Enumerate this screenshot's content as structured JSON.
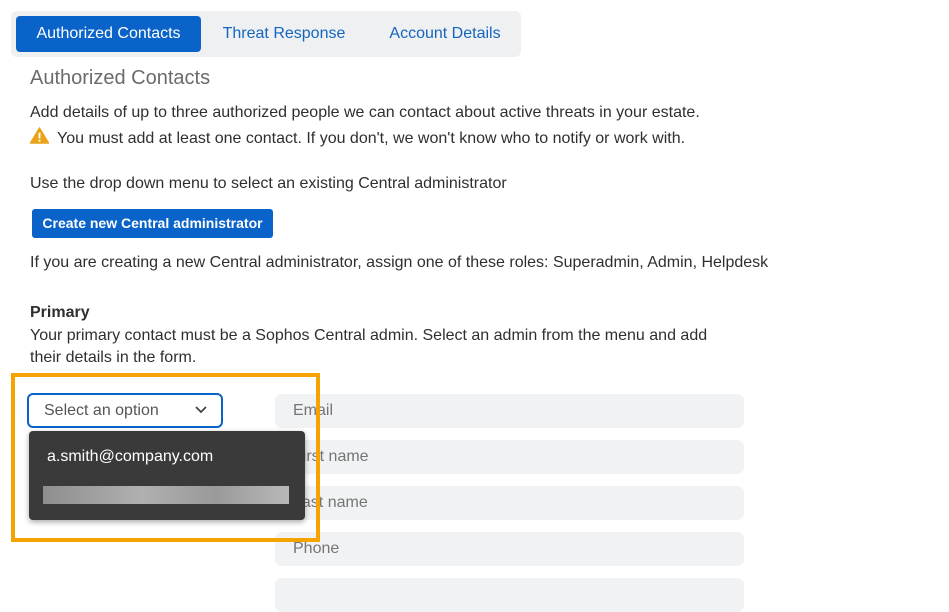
{
  "tabs": [
    {
      "label": "Authorized Contacts",
      "active": true
    },
    {
      "label": "Threat Response",
      "active": false
    },
    {
      "label": "Account Details",
      "active": false
    }
  ],
  "section_title": "Authorized Contacts",
  "intro": "Add details of up to three authorized people we can contact about active threats in your estate.",
  "warning": "You must add at least one contact. If you don't, we won't know who to notify or work with.",
  "dropdown_hint": "Use the drop down menu to select an existing Central administrator",
  "create_button": "Create new Central administrator",
  "roles_note": "If you are creating a new Central administrator, assign one of these roles: Superadmin, Admin, Helpdesk",
  "primary": {
    "heading": "Primary",
    "description_line1": "Your primary contact must be a Sophos Central admin. Select an admin from the menu and add",
    "description_line2": "their details in the form."
  },
  "select": {
    "placeholder": "Select an option",
    "options": [
      "a.smith@company.com",
      ""
    ]
  },
  "form": {
    "email_placeholder": "Email",
    "first_name_placeholder": "First name",
    "last_name_placeholder": "Last name",
    "phone_placeholder": "Phone"
  },
  "colors": {
    "accent": "#0a63c9",
    "highlight": "#f5a300",
    "warning": "#e8a317",
    "dropdown_bg": "#3a3a3a"
  }
}
